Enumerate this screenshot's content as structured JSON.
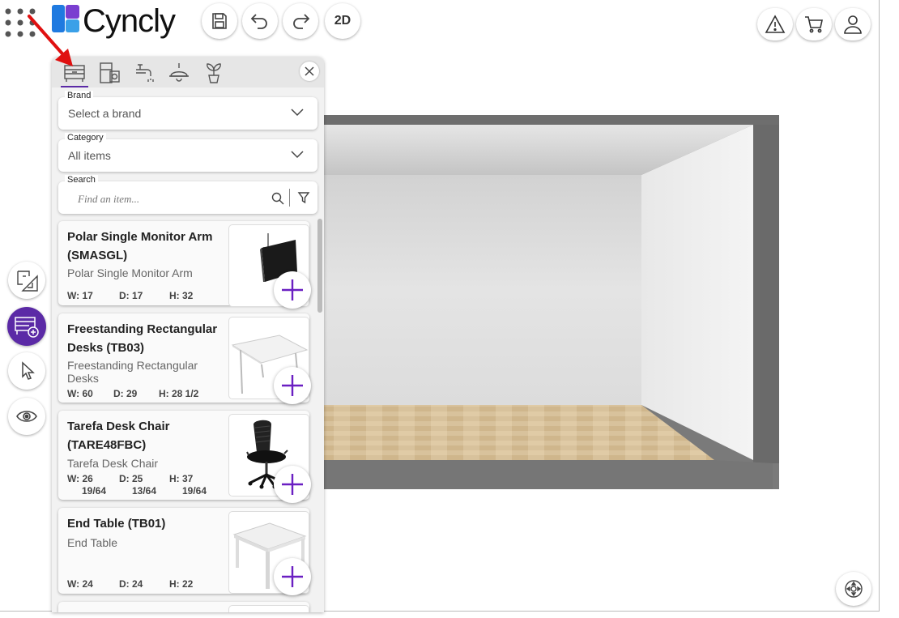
{
  "app": {
    "logo_text": "Cyncly",
    "view_mode_label": "2D"
  },
  "panel": {
    "tabs": [
      "furniture-tab",
      "appliances-tab",
      "faucets-tab",
      "lighting-tab",
      "plants-tab"
    ],
    "brand": {
      "label": "Brand",
      "value": "Select a brand"
    },
    "category": {
      "label": "Category",
      "value": "All items"
    },
    "search": {
      "label": "Search",
      "placeholder": "Find an item..."
    },
    "items": [
      {
        "title": "Polar Single Monitor Arm (SMASGL)",
        "subtitle": "Polar Single Monitor Arm",
        "w": "W: 17",
        "d": "D: 17",
        "h": "H: 32"
      },
      {
        "title": "Freestanding Rectangular Desks (TB03)",
        "subtitle": "Freestanding Rectangular Desks",
        "w": "W: 60",
        "d": "D: 29",
        "h": "H: 28 1/2"
      },
      {
        "title": "Tarefa Desk Chair (TARE48FBC)",
        "subtitle": "Tarefa Desk Chair",
        "w": "W: 26",
        "w2": "19/64",
        "d": "D: 25",
        "d2": "13/64",
        "h": "H: 37",
        "h2": "19/64"
      },
      {
        "title": "End Table (TB01)",
        "subtitle": "End Table",
        "w": "W: 24",
        "d": "D: 24",
        "h": "H: 22"
      }
    ]
  },
  "colors": {
    "accent": "#5b2aa6",
    "annotation_arrow": "#e01010"
  }
}
